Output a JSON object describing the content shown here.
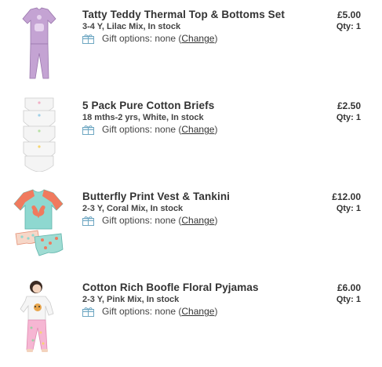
{
  "items": [
    {
      "title": "Tatty Teddy Thermal Top & Bottoms Set",
      "details": "3-4 Y, Lilac Mix, In stock",
      "gift_prefix": "Gift options: none (",
      "gift_link": "Change",
      "gift_suffix": ")",
      "price": "£5.00",
      "qty": "Qty: 1",
      "thumbnail": "lilac-thermal-set-image"
    },
    {
      "title": "5 Pack Pure Cotton Briefs",
      "details": "18 mths-2 yrs, White, In stock",
      "gift_prefix": "Gift options: none (",
      "gift_link": "Change",
      "gift_suffix": ")",
      "price": "£2.50",
      "qty": "Qty: 1",
      "thumbnail": "white-briefs-image"
    },
    {
      "title": "Butterfly Print Vest & Tankini",
      "details": "2-3 Y, Coral Mix, In stock",
      "gift_prefix": "Gift options: none (",
      "gift_link": "Change",
      "gift_suffix": ")",
      "price": "£12.00",
      "qty": "Qty: 1",
      "thumbnail": "coral-tankini-image"
    },
    {
      "title": "Cotton Rich Boofle Floral Pyjamas",
      "details": "2-3 Y, Pink Mix, In stock",
      "gift_prefix": "Gift options: none (",
      "gift_link": "Change",
      "gift_suffix": ")",
      "price": "£6.00",
      "qty": "Qty: 1",
      "thumbnail": "child-pyjamas-image"
    }
  ],
  "colors": {
    "text": "#333333",
    "gift_icon": "#6fa7c2"
  }
}
